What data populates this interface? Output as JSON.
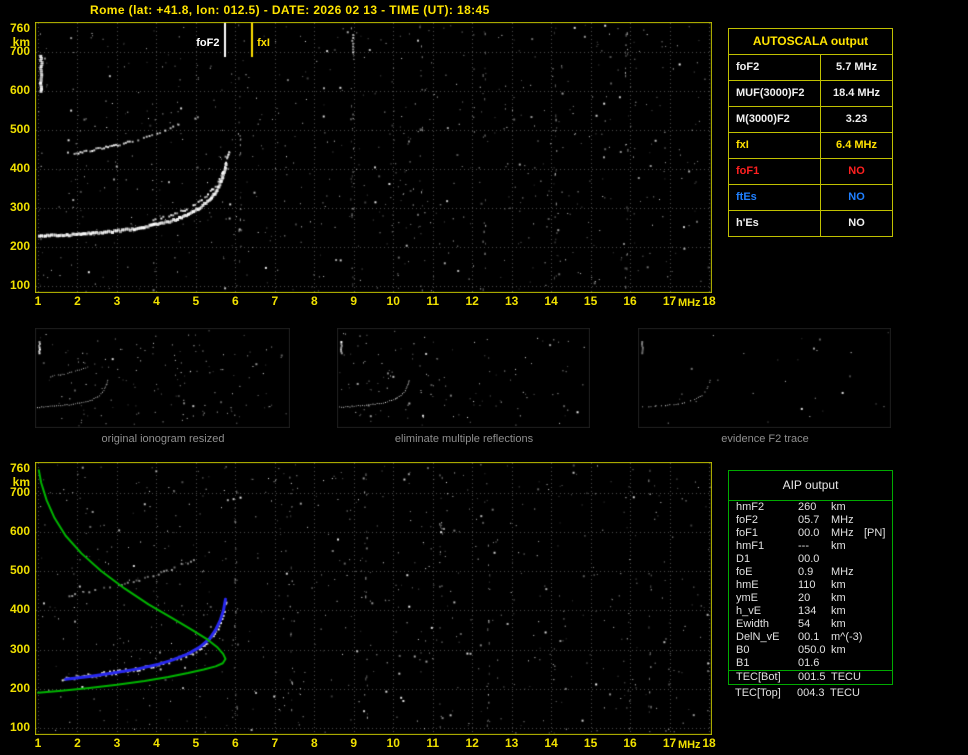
{
  "header": {
    "title": "Rome (lat: +41.8, lon: 012.5) - DATE: 2026 02 13 - TIME (UT): 18:45"
  },
  "colors": {
    "yellow": "#ffe000",
    "white": "#f0f0f0",
    "red": "#ff2020",
    "blue": "#2080ff",
    "green": "#00b400",
    "axis": "#f0e000",
    "border_yellow": "#c0c000",
    "border_green": "#00aa00",
    "caption_gray": "#8f8f8f"
  },
  "autoscala": {
    "title": "AUTOSCALA output",
    "rows": [
      {
        "param": "foF2",
        "value": "5.7 MHz",
        "color": "white"
      },
      {
        "param": "MUF(3000)F2",
        "value": "18.4 MHz",
        "color": "white"
      },
      {
        "param": "M(3000)F2",
        "value": "3.23",
        "color": "white"
      },
      {
        "param": "fxI",
        "value": "6.4 MHz",
        "color": "yellow"
      },
      {
        "param": "foF1",
        "value": "NO",
        "color": "red"
      },
      {
        "param": "ftEs",
        "value": "NO",
        "color": "blue"
      },
      {
        "param": "h'Es",
        "value": "NO",
        "color": "white"
      }
    ]
  },
  "thumbnails": [
    {
      "caption": "original ionogram resized"
    },
    {
      "caption": "eliminate multiple reflections"
    },
    {
      "caption": "evidence F2 trace"
    }
  ],
  "aip": {
    "title": "AIP output",
    "rows": [
      {
        "param": "hmF2",
        "value": "260",
        "unit": "km"
      },
      {
        "param": "foF2",
        "value": "05.7",
        "unit": "MHz"
      },
      {
        "param": "foF1",
        "value": "00.0",
        "unit": "MHz",
        "note": "[PN]"
      },
      {
        "param": "hmF1",
        "value": "---",
        "unit": "km"
      },
      {
        "param": "D1",
        "value": "00.0",
        "unit": ""
      },
      {
        "param": "foE",
        "value": "0.9",
        "unit": "MHz"
      },
      {
        "param": "hmE",
        "value": "110",
        "unit": "km"
      },
      {
        "param": "ymE",
        "value": "20",
        "unit": "km"
      },
      {
        "param": "h_vE",
        "value": "134",
        "unit": "km"
      },
      {
        "param": "Ewidth",
        "value": "54",
        "unit": "km"
      },
      {
        "param": "DelN_vE",
        "value": "00.1",
        "unit": "m^(-3)"
      },
      {
        "param": "B0",
        "value": "050.0",
        "unit": "km"
      },
      {
        "param": "B1",
        "value": "01.6",
        "unit": ""
      },
      {
        "param": "TEC[Bot]",
        "value": "001.5",
        "unit": "TECU",
        "sep": true
      },
      {
        "param": "TEC[Top]",
        "value": "004.3",
        "unit": "TECU",
        "outside": true
      }
    ]
  },
  "chart_data": [
    {
      "id": "top",
      "type": "scatter",
      "name": "ionogram",
      "x_label": "MHz",
      "y_label": "km",
      "x_range": [
        1,
        18
      ],
      "y_range": [
        100,
        760
      ],
      "x_ticks": [
        1,
        2,
        3,
        4,
        5,
        6,
        7,
        8,
        9,
        10,
        11,
        12,
        13,
        14,
        15,
        16,
        17,
        18
      ],
      "y_ticks": [
        760,
        700,
        600,
        500,
        400,
        300,
        200,
        100
      ],
      "grid": true,
      "border": "#c0c000",
      "seed": 7,
      "noise": 680,
      "streaks": [
        6.1,
        8.95,
        10.7,
        12.3,
        14.1,
        15.9
      ],
      "markers": [
        {
          "label": "foF2",
          "freq": 5.7,
          "color": "#ffffff",
          "side": "left"
        },
        {
          "label": "fxI",
          "freq": 6.4,
          "color": "#ffe000",
          "side": "right"
        }
      ],
      "traces": [
        {
          "name": "F2-trace",
          "mode": "dots",
          "color": "#ffffff",
          "size": 3,
          "step": 2,
          "jy": 2,
          "points": [
            [
              1.0,
              228
            ],
            [
              1.4,
              230
            ],
            [
              1.9,
              232
            ],
            [
              2.4,
              235
            ],
            [
              2.9,
              240
            ],
            [
              3.4,
              247
            ],
            [
              3.9,
              256
            ],
            [
              4.3,
              265
            ],
            [
              4.6,
              276
            ],
            [
              4.9,
              290
            ],
            [
              5.1,
              303
            ],
            [
              5.3,
              320
            ],
            [
              5.45,
              338
            ],
            [
              5.55,
              356
            ],
            [
              5.63,
              376
            ],
            [
              5.7,
              398
            ],
            [
              5.74,
              415
            ]
          ]
        },
        {
          "name": "F2-upper-branch",
          "mode": "dots",
          "color": "#ffffff",
          "size": 2,
          "step": 2,
          "gap": 0.3,
          "jy": 2,
          "points": [
            [
              3.9,
              268
            ],
            [
              4.3,
              280
            ],
            [
              4.7,
              295
            ],
            [
              5.0,
              311
            ],
            [
              5.25,
              331
            ],
            [
              5.45,
              353
            ],
            [
              5.6,
              377
            ],
            [
              5.7,
              402
            ],
            [
              5.78,
              430
            ],
            [
              5.83,
              448
            ]
          ]
        },
        {
          "name": "second-hop-bright",
          "mode": "dots",
          "color": "#ffffff",
          "size": 2,
          "step": 2,
          "gap": 0.05,
          "jy": 2,
          "points": [
            [
              1.9,
              438
            ],
            [
              2.4,
              450
            ],
            [
              2.9,
              460
            ],
            [
              3.3,
              470
            ]
          ]
        },
        {
          "name": "second-hop-sparse",
          "mode": "dots",
          "color": "#ffffff",
          "size": 2,
          "step": 3,
          "gap": 0.45,
          "alpha": 0.85,
          "jy": 2,
          "points": [
            [
              3.3,
              470
            ],
            [
              3.8,
              484
            ],
            [
              4.2,
              499
            ],
            [
              4.6,
              515
            ],
            [
              4.9,
              529
            ],
            [
              5.15,
              541
            ]
          ]
        },
        {
          "name": "left-noise-bar",
          "mode": "dots",
          "color": "#ffffff",
          "size": 3,
          "step": 2,
          "jx": 2,
          "jy": 0,
          "points": [
            [
              1.05,
              600
            ],
            [
              1.05,
              695
            ]
          ]
        },
        {
          "name": "interference-mark",
          "mode": "dots",
          "color": "#ffffff",
          "size": 2,
          "step": 3,
          "alpha": 0.8,
          "jx": 1,
          "jy": 0,
          "points": [
            [
              8.95,
              700
            ],
            [
              8.95,
              752
            ]
          ]
        }
      ]
    },
    {
      "id": "bottom",
      "type": "scatter",
      "name": "ionogram-with-profile",
      "x_label": "MHz",
      "y_label": "km",
      "x_range": [
        1,
        18
      ],
      "y_range": [
        100,
        760
      ],
      "x_ticks": [
        1,
        2,
        3,
        4,
        5,
        6,
        7,
        8,
        9,
        10,
        11,
        12,
        13,
        14,
        15,
        16,
        17,
        18
      ],
      "y_ticks": [
        760,
        700,
        600,
        500,
        400,
        300,
        200,
        100
      ],
      "grid": true,
      "border": "#c0c000",
      "seed": 13,
      "noise": 620,
      "streaks": [
        6.0,
        7.4,
        9.3,
        11.2,
        12.4,
        16.5
      ],
      "traces": [
        {
          "name": "measured-echoes",
          "mode": "dots",
          "color": "#ffffff",
          "size": 2,
          "step": 2,
          "gap": 0.25,
          "jy": 4,
          "points": [
            [
              1.6,
              226
            ],
            [
              2.1,
              231
            ],
            [
              2.7,
              238
            ],
            [
              3.3,
              247
            ],
            [
              3.8,
              256
            ],
            [
              4.2,
              266
            ],
            [
              4.6,
              279
            ],
            [
              4.95,
              294
            ],
            [
              5.2,
              312
            ],
            [
              5.4,
              333
            ],
            [
              5.55,
              356
            ],
            [
              5.65,
              380
            ],
            [
              5.72,
              405
            ],
            [
              5.76,
              425
            ]
          ]
        },
        {
          "name": "second-hop",
          "mode": "dots",
          "color": "#ffffff",
          "size": 2,
          "step": 3,
          "gap": 0.5,
          "alpha": 0.6,
          "jy": 2,
          "points": [
            [
              1.7,
              435
            ],
            [
              2.2,
              446
            ],
            [
              2.8,
              458
            ],
            [
              3.4,
              472
            ],
            [
              3.9,
              487
            ],
            [
              4.3,
              502
            ],
            [
              4.7,
              518
            ],
            [
              5.0,
              530
            ]
          ]
        },
        {
          "name": "fitted-trace-blue",
          "mode": "line",
          "color": "#2828f0",
          "width": 3,
          "points": [
            [
              1.7,
              224
            ],
            [
              2.3,
              231
            ],
            [
              2.9,
              240
            ],
            [
              3.5,
              250
            ],
            [
              4.0,
              261
            ],
            [
              4.4,
              273
            ],
            [
              4.8,
              289
            ],
            [
              5.1,
              306
            ],
            [
              5.35,
              328
            ],
            [
              5.5,
              350
            ],
            [
              5.62,
              375
            ],
            [
              5.7,
              400
            ],
            [
              5.75,
              428
            ]
          ]
        },
        {
          "name": "electron-density-profile-green",
          "mode": "line",
          "color": "#00b400",
          "width": 2,
          "points": [
            [
              1.0,
              190
            ],
            [
              1.6,
              195
            ],
            [
              2.3,
              202
            ],
            [
              3.0,
              210
            ],
            [
              3.7,
              220
            ],
            [
              4.3,
              230
            ],
            [
              4.8,
              240
            ],
            [
              5.2,
              249
            ],
            [
              5.5,
              257
            ],
            [
              5.68,
              265
            ],
            [
              5.75,
              276
            ],
            [
              5.69,
              289
            ],
            [
              5.55,
              305
            ],
            [
              5.3,
              325
            ],
            [
              4.9,
              350
            ],
            [
              4.4,
              380
            ],
            [
              3.8,
              415
            ],
            [
              3.2,
              455
            ],
            [
              2.6,
              500
            ],
            [
              2.1,
              545
            ],
            [
              1.7,
              590
            ],
            [
              1.42,
              635
            ],
            [
              1.22,
              680
            ],
            [
              1.08,
              725
            ],
            [
              1.02,
              757
            ]
          ]
        }
      ]
    },
    {
      "id": "thumb1",
      "type": "scatter",
      "name": "original-ionogram-resized",
      "x_range": [
        1,
        18
      ],
      "y_range": [
        100,
        760
      ],
      "grid": false,
      "border": "#1e1e1e",
      "seed": 21,
      "noise": 150,
      "traces": [
        {
          "name": "F2-trace",
          "mode": "dots",
          "color": "#ffffff",
          "size": 1,
          "step": 2,
          "jy": 1,
          "points": [
            [
              1.0,
              228
            ],
            [
              2.0,
              235
            ],
            [
              3.0,
              244
            ],
            [
              4.0,
              258
            ],
            [
              4.7,
              280
            ],
            [
              5.2,
              310
            ],
            [
              5.5,
              345
            ],
            [
              5.7,
              390
            ],
            [
              5.78,
              425
            ]
          ]
        },
        {
          "name": "second-hop",
          "mode": "dots",
          "color": "#ffffff",
          "size": 1,
          "step": 2,
          "gap": 0.3,
          "alpha": 0.8,
          "jy": 1,
          "points": [
            [
              1.9,
              440
            ],
            [
              2.8,
              458
            ],
            [
              3.7,
              482
            ],
            [
              4.4,
              505
            ],
            [
              5.0,
              528
            ]
          ]
        },
        {
          "name": "left-noise-bar",
          "mode": "dots",
          "color": "#ffffff",
          "size": 2,
          "step": 2,
          "jx": 1,
          "jy": 0,
          "points": [
            [
              1.1,
              600
            ],
            [
              1.1,
              690
            ]
          ]
        }
      ]
    },
    {
      "id": "thumb2",
      "type": "scatter",
      "name": "eliminate-multiple-reflections",
      "x_range": [
        1,
        18
      ],
      "y_range": [
        100,
        760
      ],
      "grid": false,
      "border": "#1e1e1e",
      "seed": 22,
      "noise": 130,
      "traces": [
        {
          "name": "F2-trace",
          "mode": "dots",
          "color": "#ffffff",
          "size": 1,
          "step": 2,
          "jy": 1,
          "points": [
            [
              1.0,
              228
            ],
            [
              2.0,
              235
            ],
            [
              3.0,
              244
            ],
            [
              4.0,
              258
            ],
            [
              4.7,
              280
            ],
            [
              5.2,
              310
            ],
            [
              5.5,
              345
            ],
            [
              5.7,
              390
            ],
            [
              5.78,
              425
            ]
          ]
        },
        {
          "name": "left-noise-bar",
          "mode": "dots",
          "color": "#ffffff",
          "size": 2,
          "step": 2,
          "jx": 1,
          "jy": 0,
          "points": [
            [
              1.1,
              600
            ],
            [
              1.1,
              690
            ]
          ]
        }
      ]
    },
    {
      "id": "thumb3",
      "type": "scatter",
      "name": "evidence-F2-trace",
      "x_range": [
        1,
        18
      ],
      "y_range": [
        100,
        760
      ],
      "grid": false,
      "border": "#1e1e1e",
      "seed": 23,
      "noise": 28,
      "traces": [
        {
          "name": "F2-trace",
          "mode": "dots",
          "color": "#ffffff",
          "size": 1,
          "step": 2,
          "gap": 0.4,
          "jy": 1,
          "points": [
            [
              1.0,
              228
            ],
            [
              2.0,
              235
            ],
            [
              3.0,
              244
            ],
            [
              4.0,
              258
            ],
            [
              4.7,
              280
            ],
            [
              5.2,
              310
            ],
            [
              5.5,
              345
            ],
            [
              5.7,
              390
            ],
            [
              5.78,
              425
            ]
          ]
        },
        {
          "name": "left-noise-bar",
          "mode": "dots",
          "color": "#ffffff",
          "size": 2,
          "step": 2,
          "alpha": 0.6,
          "jx": 1,
          "jy": 0,
          "points": [
            [
              1.1,
              600
            ],
            [
              1.1,
              690
            ]
          ]
        }
      ]
    }
  ]
}
